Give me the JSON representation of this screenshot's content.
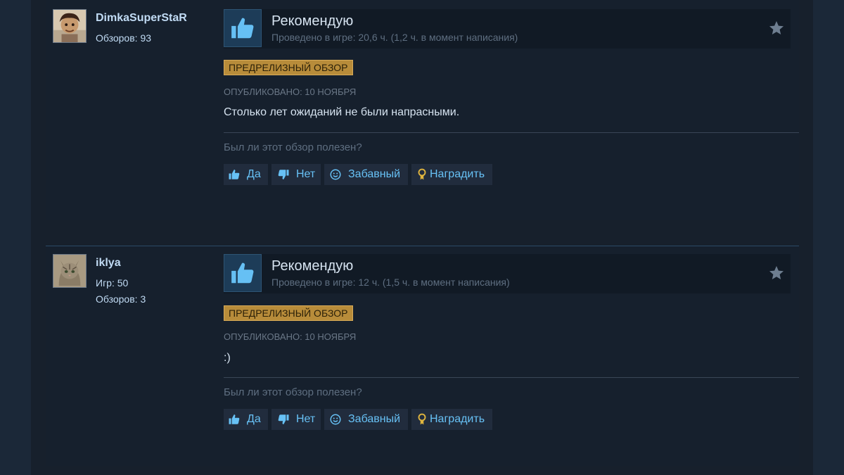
{
  "reviews": [
    {
      "author": {
        "name": "DimkaSuperStaR",
        "stats": [
          "Обзоров: 93"
        ]
      },
      "verdict": "Рекомендую",
      "playtime": "Проведено в игре: 20,6 ч. (1,2 ч. в момент написания)",
      "badge": "ПРЕДРЕЛИЗНЫЙ ОБЗОР",
      "posted": "ОПУБЛИКОВАНО: 10 НОЯБРЯ",
      "text": "Столько лет ожиданий не были напрасными.",
      "helpful_question": "Был ли этот обзор полезен?",
      "buttons": {
        "yes": "Да",
        "no": "Нет",
        "funny": "Забавный",
        "award": "Наградить"
      }
    },
    {
      "author": {
        "name": "iklya",
        "stats": [
          "Игр: 50",
          "Обзоров: 3"
        ]
      },
      "verdict": "Рекомендую",
      "playtime": "Проведено в игре: 12 ч. (1,5 ч. в момент написания)",
      "badge": "ПРЕДРЕЛИЗНЫЙ ОБЗОР",
      "posted": "ОПУБЛИКОВАНО: 10 НОЯБРЯ",
      "text": ":)",
      "helpful_question": "Был ли этот обзор полезен?",
      "buttons": {
        "yes": "Да",
        "no": "Нет",
        "funny": "Забавный",
        "award": "Наградить"
      }
    }
  ],
  "icons": {
    "verdict": "thumbs-up-icon",
    "favorite": "star-icon",
    "yes": "thumbs-up-icon",
    "no": "thumbs-down-icon",
    "funny": "smiley-icon",
    "award": "award-icon"
  },
  "colors": {
    "page_background": "#1b2838",
    "card_background": "#16202d",
    "accent_blue": "#67c1f5",
    "badge_gold": "#b88c3a",
    "text_primary": "#d6e3f0",
    "text_muted": "#5e6e80"
  }
}
